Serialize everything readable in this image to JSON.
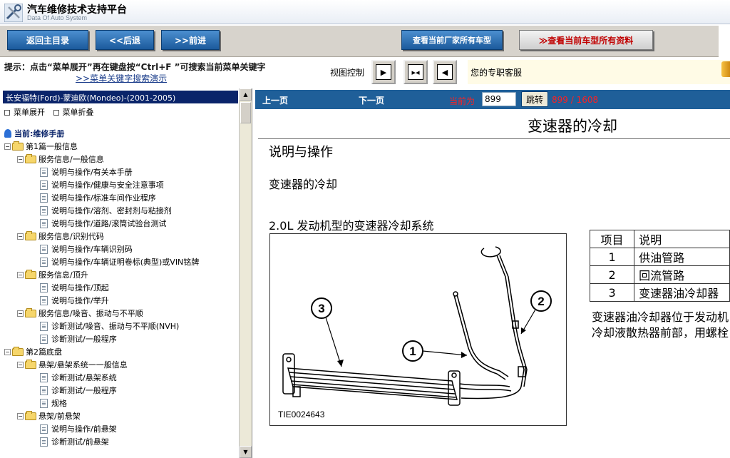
{
  "app": {
    "title": "汽车维修技术支持平台",
    "subtitle": "Data Of Auto System"
  },
  "nav": {
    "home": "返回主目录",
    "back": "<<后退",
    "forward": ">>前进",
    "makers_models": "查看当前厂家所有车型",
    "all_model_docs": "≫查看当前车型所有资料"
  },
  "hint": {
    "text": "提示：点击“菜单展开”再在键盘按“Ctrl+F ”可搜索当前菜单关键字",
    "link": ">>菜单关键字搜索演示",
    "view_label": "视图控制",
    "support": "您的专职客服"
  },
  "tree": {
    "model": "长安福特(Ford)-蒙迪欧(Mondeo)-(2001-2005)",
    "expand": "菜单展开",
    "collapse": "菜单折叠",
    "root": "当前:维修手册",
    "nodes": [
      {
        "level": 0,
        "type": "folder",
        "label": "第1篇一般信息"
      },
      {
        "level": 1,
        "type": "folder",
        "label": "服务信息/一般信息"
      },
      {
        "level": 2,
        "type": "doc",
        "label": "说明与操作/有关本手册"
      },
      {
        "level": 2,
        "type": "doc",
        "label": "说明与操作/健康与安全注意事项"
      },
      {
        "level": 2,
        "type": "doc",
        "label": "说明与操作/标准车间作业程序"
      },
      {
        "level": 2,
        "type": "doc",
        "label": "说明与操作/溶剂、密封剂与粘接剂"
      },
      {
        "level": 2,
        "type": "doc",
        "label": "说明与操作/道路/滚筒试验台测试"
      },
      {
        "level": 1,
        "type": "folder",
        "label": "服务信息/识别代码"
      },
      {
        "level": 2,
        "type": "doc",
        "label": "说明与操作/车辆识别码"
      },
      {
        "level": 2,
        "type": "doc",
        "label": "说明与操作/车辆证明卷标(典型)或VIN铭牌"
      },
      {
        "level": 1,
        "type": "folder",
        "label": "服务信息/顶升"
      },
      {
        "level": 2,
        "type": "doc",
        "label": "说明与操作/顶起"
      },
      {
        "level": 2,
        "type": "doc",
        "label": "说明与操作/举升"
      },
      {
        "level": 1,
        "type": "folder",
        "label": "服务信息/噪音、振动与不平顺"
      },
      {
        "level": 2,
        "type": "doc",
        "label": "诊断测试/噪音、振动与不平顺(NVH)"
      },
      {
        "level": 2,
        "type": "doc",
        "label": "诊断测试/一般程序"
      },
      {
        "level": 0,
        "type": "folder",
        "label": "第2篇底盘"
      },
      {
        "level": 1,
        "type": "folder",
        "label": "悬架/悬架系统一一般信息"
      },
      {
        "level": 2,
        "type": "doc",
        "label": "诊断测试/悬架系统"
      },
      {
        "level": 2,
        "type": "doc",
        "label": "诊断测试/一般程序"
      },
      {
        "level": 2,
        "type": "doc",
        "label": "规格"
      },
      {
        "level": 1,
        "type": "folder",
        "label": "悬架/前悬架"
      },
      {
        "level": 2,
        "type": "doc",
        "label": "说明与操作/前悬架"
      },
      {
        "level": 2,
        "type": "doc",
        "label": "诊断测试/前悬架"
      }
    ]
  },
  "pager": {
    "prev": "上一页",
    "next": "下一页",
    "current_label": "当前为",
    "current_page": "899",
    "jump": "跳转",
    "position": "899 / 1608"
  },
  "doc": {
    "title": "变速器的冷却",
    "section": "说明与操作",
    "subsection": "变速器的冷却",
    "figure_caption": "2.0L 发动机型的变速器冷却系统",
    "figure_code": "TIE0024643",
    "callouts": [
      "1",
      "2",
      "3"
    ],
    "table_header": {
      "item": "项目",
      "desc": "说明"
    },
    "table_rows": [
      {
        "item": "1",
        "desc": "供油管路"
      },
      {
        "item": "2",
        "desc": "回流管路"
      },
      {
        "item": "3",
        "desc": "变速器油冷却器"
      }
    ],
    "note": "变速器油冷却器位于发动机冷却液散热器前部，用螺栓固定。"
  }
}
